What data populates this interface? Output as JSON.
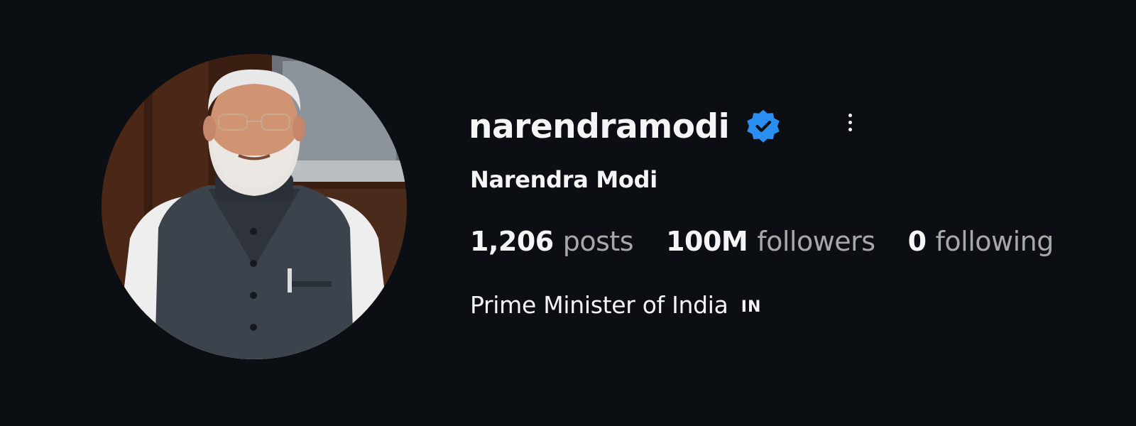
{
  "profile": {
    "username": "narendramodi",
    "full_name": "Narendra Modi",
    "bio": "Prime Minister of India",
    "bio_flag": "IN",
    "verified": true,
    "stats": {
      "posts_count": "1,206",
      "posts_label": "posts",
      "followers_count": "100M",
      "followers_label": "followers",
      "following_count": "0",
      "following_label": "following"
    }
  },
  "icons": {
    "verified_badge": "verified-badge-icon",
    "more_options": "more-options-icon"
  },
  "colors": {
    "background": "#0b0e13",
    "text_primary": "#f5f5f5",
    "text_secondary": "#a8a8a8",
    "verified_blue": "#2a8ef0"
  }
}
